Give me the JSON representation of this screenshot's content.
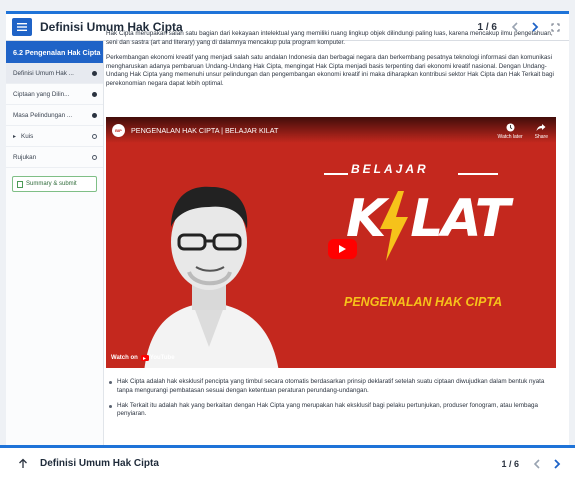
{
  "header": {
    "title": "Definisi Umum Hak Cipta",
    "counter": "1 / 6"
  },
  "sidebar": {
    "section": "6.2 Pengenalan Hak Cipta",
    "items": [
      {
        "label": "Definisi Umum Hak ...",
        "state": "done"
      },
      {
        "label": "Ciptaan yang Dilin...",
        "state": "done"
      },
      {
        "label": "Masa Pelindungan ...",
        "state": "done"
      },
      {
        "label": "Kuis",
        "state": "open"
      },
      {
        "label": "Rujukan",
        "state": "open"
      }
    ],
    "summary_label": "Summary & submit"
  },
  "content": {
    "para1": "Hak Cipta merupakan salah satu bagian dari kekayaan intelektual yang memiliki ruang lingkup objek dilindungi paling luas, karena mencakup ilmu pengetahuan, seni dan sastra (art and literary) yang di dalamnya mencakup pula program komputer.",
    "para2": "Perkembangan ekonomi kreatif yang menjadi salah satu andalan Indonesia dan berbagai negara dan berkembang pesatnya teknologi informasi dan komunikasi mengharuskan adanya pembaruan Undang-Undang Hak Cipta, mengingat Hak Cipta menjadi basis terpenting dari ekonomi kreatif nasional. Dengan Undang-Undang Hak Cipta yang memenuhi unsur pelindungan dan pengembangan ekonomi kreatif ini maka diharapkan kontribusi sektor Hak Cipta dan Hak Terkait bagi perekonomian negara dapat lebih optimal.",
    "bullets": [
      "Hak Cipta adalah hak eksklusif pencipta yang timbul secara otomatis berdasarkan prinsip deklaratif setelah suatu ciptaan diwujudkan dalam bentuk nyata tanpa mengurangi pembatasan sesuai dengan ketentuan peraturan perundang-undangan.",
      "Hak Terkait itu adalah hak yang berkaitan dengan Hak Cipta yang merupakan hak eksklusif bagi pelaku pertunjukan, produser fonogram, atau lembaga penyiaran."
    ]
  },
  "video": {
    "title": "PENGENALAN HAK CIPTA | BELAJAR KILAT",
    "channel_logo_text": "BIP",
    "watch_later": "Watch later",
    "share": "Share",
    "thumb_belajar": "BELAJAR",
    "thumb_kilat_k": "K",
    "thumb_kilat_rest": "LAT",
    "thumb_subtitle": "PENGENALAN HAK CIPTA",
    "watch_on": "Watch on",
    "youtube": "YouTube",
    "colors": {
      "background": "#c4281e",
      "accent": "#f6c21a"
    }
  },
  "footer": {
    "title": "Definisi Umum Hak Cipta",
    "counter": "1 / 6"
  }
}
